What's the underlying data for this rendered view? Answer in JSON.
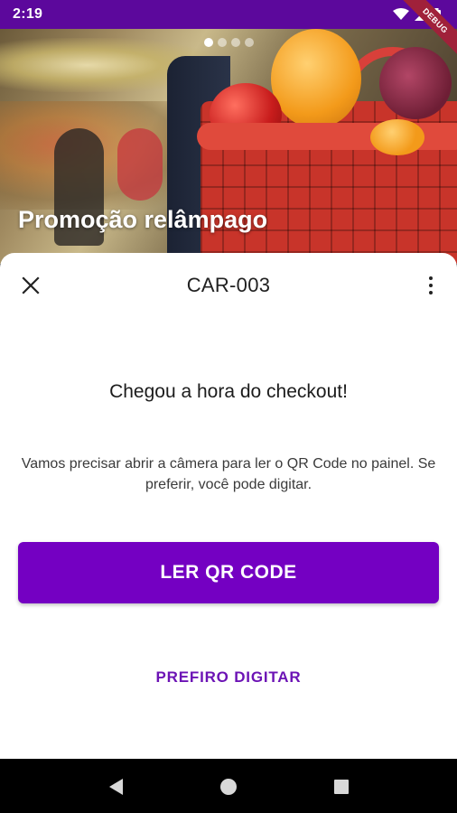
{
  "status_bar": {
    "time": "2:19",
    "debug_label": "DEBUG"
  },
  "banner": {
    "title": "Promoção relâmpago",
    "page_count": 4,
    "active_page": 0
  },
  "sheet": {
    "title": "CAR-003",
    "heading": "Chegou a hora do checkout!",
    "description": "Vamos precisar abrir a câmera para ler o QR Code no painel. Se preferir, você pode digitar.",
    "primary_button": "LER QR CODE",
    "secondary_button": "PREFIRO DIGITAR"
  },
  "colors": {
    "status_bar": "#5c089c",
    "primary": "#7400c2",
    "link": "#6c13b5"
  },
  "icons": {
    "close": "close-icon",
    "more": "more-vert-icon",
    "wifi": "wifi-icon",
    "signal": "signal-icon",
    "battery": "battery-icon"
  }
}
